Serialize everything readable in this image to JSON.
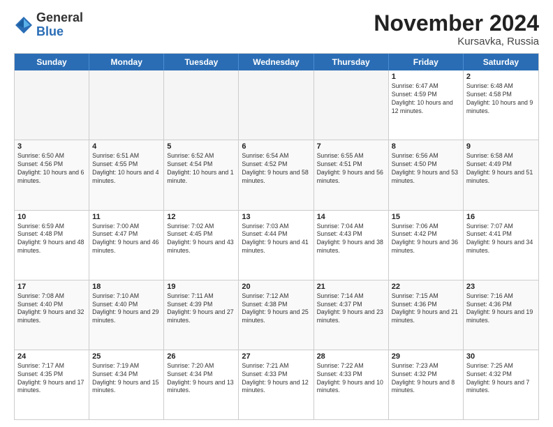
{
  "logo": {
    "general": "General",
    "blue": "Blue"
  },
  "header": {
    "month": "November 2024",
    "location": "Kursavka, Russia"
  },
  "weekdays": [
    "Sunday",
    "Monday",
    "Tuesday",
    "Wednesday",
    "Thursday",
    "Friday",
    "Saturday"
  ],
  "weeks": [
    [
      {
        "day": "",
        "info": "",
        "empty": true
      },
      {
        "day": "",
        "info": "",
        "empty": true
      },
      {
        "day": "",
        "info": "",
        "empty": true
      },
      {
        "day": "",
        "info": "",
        "empty": true
      },
      {
        "day": "",
        "info": "",
        "empty": true
      },
      {
        "day": "1",
        "info": "Sunrise: 6:47 AM\nSunset: 4:59 PM\nDaylight: 10 hours\nand 12 minutes."
      },
      {
        "day": "2",
        "info": "Sunrise: 6:48 AM\nSunset: 4:58 PM\nDaylight: 10 hours\nand 9 minutes."
      }
    ],
    [
      {
        "day": "3",
        "info": "Sunrise: 6:50 AM\nSunset: 4:56 PM\nDaylight: 10 hours\nand 6 minutes."
      },
      {
        "day": "4",
        "info": "Sunrise: 6:51 AM\nSunset: 4:55 PM\nDaylight: 10 hours\nand 4 minutes."
      },
      {
        "day": "5",
        "info": "Sunrise: 6:52 AM\nSunset: 4:54 PM\nDaylight: 10 hours\nand 1 minute."
      },
      {
        "day": "6",
        "info": "Sunrise: 6:54 AM\nSunset: 4:52 PM\nDaylight: 9 hours\nand 58 minutes."
      },
      {
        "day": "7",
        "info": "Sunrise: 6:55 AM\nSunset: 4:51 PM\nDaylight: 9 hours\nand 56 minutes."
      },
      {
        "day": "8",
        "info": "Sunrise: 6:56 AM\nSunset: 4:50 PM\nDaylight: 9 hours\nand 53 minutes."
      },
      {
        "day": "9",
        "info": "Sunrise: 6:58 AM\nSunset: 4:49 PM\nDaylight: 9 hours\nand 51 minutes."
      }
    ],
    [
      {
        "day": "10",
        "info": "Sunrise: 6:59 AM\nSunset: 4:48 PM\nDaylight: 9 hours\nand 48 minutes."
      },
      {
        "day": "11",
        "info": "Sunrise: 7:00 AM\nSunset: 4:47 PM\nDaylight: 9 hours\nand 46 minutes."
      },
      {
        "day": "12",
        "info": "Sunrise: 7:02 AM\nSunset: 4:45 PM\nDaylight: 9 hours\nand 43 minutes."
      },
      {
        "day": "13",
        "info": "Sunrise: 7:03 AM\nSunset: 4:44 PM\nDaylight: 9 hours\nand 41 minutes."
      },
      {
        "day": "14",
        "info": "Sunrise: 7:04 AM\nSunset: 4:43 PM\nDaylight: 9 hours\nand 38 minutes."
      },
      {
        "day": "15",
        "info": "Sunrise: 7:06 AM\nSunset: 4:42 PM\nDaylight: 9 hours\nand 36 minutes."
      },
      {
        "day": "16",
        "info": "Sunrise: 7:07 AM\nSunset: 4:41 PM\nDaylight: 9 hours\nand 34 minutes."
      }
    ],
    [
      {
        "day": "17",
        "info": "Sunrise: 7:08 AM\nSunset: 4:40 PM\nDaylight: 9 hours\nand 32 minutes."
      },
      {
        "day": "18",
        "info": "Sunrise: 7:10 AM\nSunset: 4:40 PM\nDaylight: 9 hours\nand 29 minutes."
      },
      {
        "day": "19",
        "info": "Sunrise: 7:11 AM\nSunset: 4:39 PM\nDaylight: 9 hours\nand 27 minutes."
      },
      {
        "day": "20",
        "info": "Sunrise: 7:12 AM\nSunset: 4:38 PM\nDaylight: 9 hours\nand 25 minutes."
      },
      {
        "day": "21",
        "info": "Sunrise: 7:14 AM\nSunset: 4:37 PM\nDaylight: 9 hours\nand 23 minutes."
      },
      {
        "day": "22",
        "info": "Sunrise: 7:15 AM\nSunset: 4:36 PM\nDaylight: 9 hours\nand 21 minutes."
      },
      {
        "day": "23",
        "info": "Sunrise: 7:16 AM\nSunset: 4:36 PM\nDaylight: 9 hours\nand 19 minutes."
      }
    ],
    [
      {
        "day": "24",
        "info": "Sunrise: 7:17 AM\nSunset: 4:35 PM\nDaylight: 9 hours\nand 17 minutes."
      },
      {
        "day": "25",
        "info": "Sunrise: 7:19 AM\nSunset: 4:34 PM\nDaylight: 9 hours\nand 15 minutes."
      },
      {
        "day": "26",
        "info": "Sunrise: 7:20 AM\nSunset: 4:34 PM\nDaylight: 9 hours\nand 13 minutes."
      },
      {
        "day": "27",
        "info": "Sunrise: 7:21 AM\nSunset: 4:33 PM\nDaylight: 9 hours\nand 12 minutes."
      },
      {
        "day": "28",
        "info": "Sunrise: 7:22 AM\nSunset: 4:33 PM\nDaylight: 9 hours\nand 10 minutes."
      },
      {
        "day": "29",
        "info": "Sunrise: 7:23 AM\nSunset: 4:32 PM\nDaylight: 9 hours\nand 8 minutes."
      },
      {
        "day": "30",
        "info": "Sunrise: 7:25 AM\nSunset: 4:32 PM\nDaylight: 9 hours\nand 7 minutes."
      }
    ]
  ]
}
